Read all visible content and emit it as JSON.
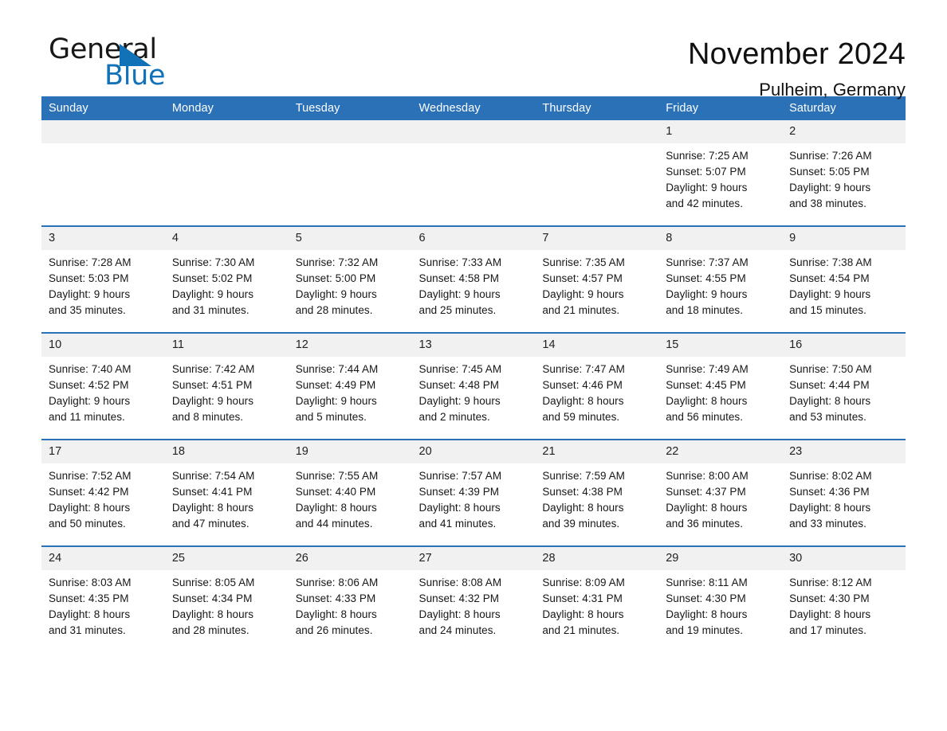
{
  "logo": {
    "text_primary": "General",
    "text_secondary": "Blue",
    "triangle_color": "#1272b8"
  },
  "header": {
    "title": "November 2024",
    "subtitle": "Pulheim, Germany",
    "accent_color": "#2b71b8",
    "daynum_background": "#f1f1f1"
  },
  "calendar": {
    "weekday_headers": [
      "Sunday",
      "Monday",
      "Tuesday",
      "Wednesday",
      "Thursday",
      "Friday",
      "Saturday"
    ],
    "weeks": [
      [
        {
          "day": "",
          "blank": true,
          "lines": [
            "",
            "",
            "",
            ""
          ]
        },
        {
          "day": "",
          "blank": true,
          "lines": [
            "",
            "",
            "",
            ""
          ]
        },
        {
          "day": "",
          "blank": true,
          "lines": [
            "",
            "",
            "",
            ""
          ]
        },
        {
          "day": "",
          "blank": true,
          "lines": [
            "",
            "",
            "",
            ""
          ]
        },
        {
          "day": "",
          "blank": true,
          "lines": [
            "",
            "",
            "",
            ""
          ]
        },
        {
          "day": "1",
          "blank": false,
          "lines": [
            "Sunrise: 7:25 AM",
            "Sunset: 5:07 PM",
            "Daylight: 9 hours",
            "and 42 minutes."
          ]
        },
        {
          "day": "2",
          "blank": false,
          "lines": [
            "Sunrise: 7:26 AM",
            "Sunset: 5:05 PM",
            "Daylight: 9 hours",
            "and 38 minutes."
          ]
        }
      ],
      [
        {
          "day": "3",
          "blank": false,
          "lines": [
            "Sunrise: 7:28 AM",
            "Sunset: 5:03 PM",
            "Daylight: 9 hours",
            "and 35 minutes."
          ]
        },
        {
          "day": "4",
          "blank": false,
          "lines": [
            "Sunrise: 7:30 AM",
            "Sunset: 5:02 PM",
            "Daylight: 9 hours",
            "and 31 minutes."
          ]
        },
        {
          "day": "5",
          "blank": false,
          "lines": [
            "Sunrise: 7:32 AM",
            "Sunset: 5:00 PM",
            "Daylight: 9 hours",
            "and 28 minutes."
          ]
        },
        {
          "day": "6",
          "blank": false,
          "lines": [
            "Sunrise: 7:33 AM",
            "Sunset: 4:58 PM",
            "Daylight: 9 hours",
            "and 25 minutes."
          ]
        },
        {
          "day": "7",
          "blank": false,
          "lines": [
            "Sunrise: 7:35 AM",
            "Sunset: 4:57 PM",
            "Daylight: 9 hours",
            "and 21 minutes."
          ]
        },
        {
          "day": "8",
          "blank": false,
          "lines": [
            "Sunrise: 7:37 AM",
            "Sunset: 4:55 PM",
            "Daylight: 9 hours",
            "and 18 minutes."
          ]
        },
        {
          "day": "9",
          "blank": false,
          "lines": [
            "Sunrise: 7:38 AM",
            "Sunset: 4:54 PM",
            "Daylight: 9 hours",
            "and 15 minutes."
          ]
        }
      ],
      [
        {
          "day": "10",
          "blank": false,
          "lines": [
            "Sunrise: 7:40 AM",
            "Sunset: 4:52 PM",
            "Daylight: 9 hours",
            "and 11 minutes."
          ]
        },
        {
          "day": "11",
          "blank": false,
          "lines": [
            "Sunrise: 7:42 AM",
            "Sunset: 4:51 PM",
            "Daylight: 9 hours",
            "and 8 minutes."
          ]
        },
        {
          "day": "12",
          "blank": false,
          "lines": [
            "Sunrise: 7:44 AM",
            "Sunset: 4:49 PM",
            "Daylight: 9 hours",
            "and 5 minutes."
          ]
        },
        {
          "day": "13",
          "blank": false,
          "lines": [
            "Sunrise: 7:45 AM",
            "Sunset: 4:48 PM",
            "Daylight: 9 hours",
            "and 2 minutes."
          ]
        },
        {
          "day": "14",
          "blank": false,
          "lines": [
            "Sunrise: 7:47 AM",
            "Sunset: 4:46 PM",
            "Daylight: 8 hours",
            "and 59 minutes."
          ]
        },
        {
          "day": "15",
          "blank": false,
          "lines": [
            "Sunrise: 7:49 AM",
            "Sunset: 4:45 PM",
            "Daylight: 8 hours",
            "and 56 minutes."
          ]
        },
        {
          "day": "16",
          "blank": false,
          "lines": [
            "Sunrise: 7:50 AM",
            "Sunset: 4:44 PM",
            "Daylight: 8 hours",
            "and 53 minutes."
          ]
        }
      ],
      [
        {
          "day": "17",
          "blank": false,
          "lines": [
            "Sunrise: 7:52 AM",
            "Sunset: 4:42 PM",
            "Daylight: 8 hours",
            "and 50 minutes."
          ]
        },
        {
          "day": "18",
          "blank": false,
          "lines": [
            "Sunrise: 7:54 AM",
            "Sunset: 4:41 PM",
            "Daylight: 8 hours",
            "and 47 minutes."
          ]
        },
        {
          "day": "19",
          "blank": false,
          "lines": [
            "Sunrise: 7:55 AM",
            "Sunset: 4:40 PM",
            "Daylight: 8 hours",
            "and 44 minutes."
          ]
        },
        {
          "day": "20",
          "blank": false,
          "lines": [
            "Sunrise: 7:57 AM",
            "Sunset: 4:39 PM",
            "Daylight: 8 hours",
            "and 41 minutes."
          ]
        },
        {
          "day": "21",
          "blank": false,
          "lines": [
            "Sunrise: 7:59 AM",
            "Sunset: 4:38 PM",
            "Daylight: 8 hours",
            "and 39 minutes."
          ]
        },
        {
          "day": "22",
          "blank": false,
          "lines": [
            "Sunrise: 8:00 AM",
            "Sunset: 4:37 PM",
            "Daylight: 8 hours",
            "and 36 minutes."
          ]
        },
        {
          "day": "23",
          "blank": false,
          "lines": [
            "Sunrise: 8:02 AM",
            "Sunset: 4:36 PM",
            "Daylight: 8 hours",
            "and 33 minutes."
          ]
        }
      ],
      [
        {
          "day": "24",
          "blank": false,
          "lines": [
            "Sunrise: 8:03 AM",
            "Sunset: 4:35 PM",
            "Daylight: 8 hours",
            "and 31 minutes."
          ]
        },
        {
          "day": "25",
          "blank": false,
          "lines": [
            "Sunrise: 8:05 AM",
            "Sunset: 4:34 PM",
            "Daylight: 8 hours",
            "and 28 minutes."
          ]
        },
        {
          "day": "26",
          "blank": false,
          "lines": [
            "Sunrise: 8:06 AM",
            "Sunset: 4:33 PM",
            "Daylight: 8 hours",
            "and 26 minutes."
          ]
        },
        {
          "day": "27",
          "blank": false,
          "lines": [
            "Sunrise: 8:08 AM",
            "Sunset: 4:32 PM",
            "Daylight: 8 hours",
            "and 24 minutes."
          ]
        },
        {
          "day": "28",
          "blank": false,
          "lines": [
            "Sunrise: 8:09 AM",
            "Sunset: 4:31 PM",
            "Daylight: 8 hours",
            "and 21 minutes."
          ]
        },
        {
          "day": "29",
          "blank": false,
          "lines": [
            "Sunrise: 8:11 AM",
            "Sunset: 4:30 PM",
            "Daylight: 8 hours",
            "and 19 minutes."
          ]
        },
        {
          "day": "30",
          "blank": false,
          "lines": [
            "Sunrise: 8:12 AM",
            "Sunset: 4:30 PM",
            "Daylight: 8 hours",
            "and 17 minutes."
          ]
        }
      ]
    ]
  }
}
